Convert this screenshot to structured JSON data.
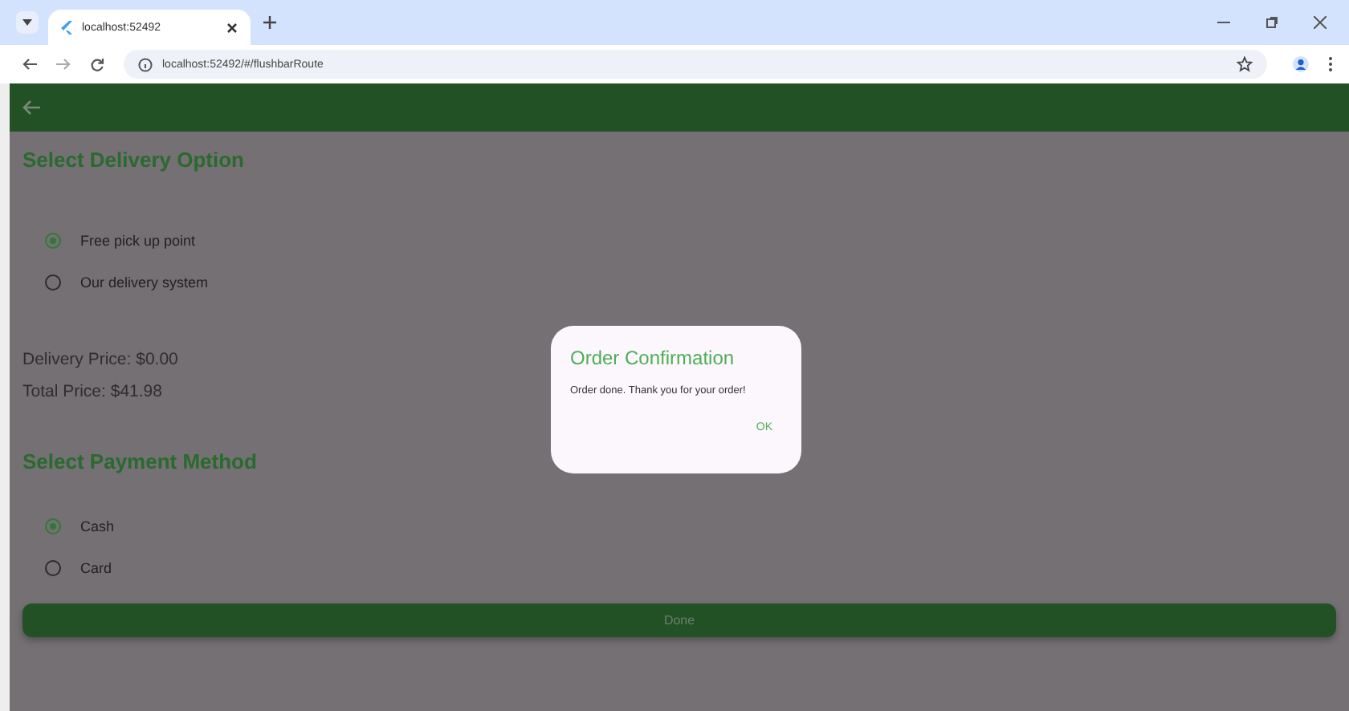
{
  "browser": {
    "tab_title": "localhost:52492",
    "url": "localhost:52492/#/flushbarRoute"
  },
  "delivery": {
    "heading": "Select Delivery Option",
    "options": [
      {
        "label": "Free pick up point",
        "selected": true
      },
      {
        "label": "Our delivery system",
        "selected": false
      }
    ]
  },
  "prices": {
    "delivery": "Delivery Price: $0.00",
    "total": "Total Price: $41.98"
  },
  "payment": {
    "heading": "Select Payment Method",
    "options": [
      {
        "label": "Cash",
        "selected": true
      },
      {
        "label": "Card",
        "selected": false
      }
    ]
  },
  "done_button": "Done",
  "dialog": {
    "title": "Order Confirmation",
    "message": "Order done. Thank you for your order!",
    "button": "OK"
  }
}
